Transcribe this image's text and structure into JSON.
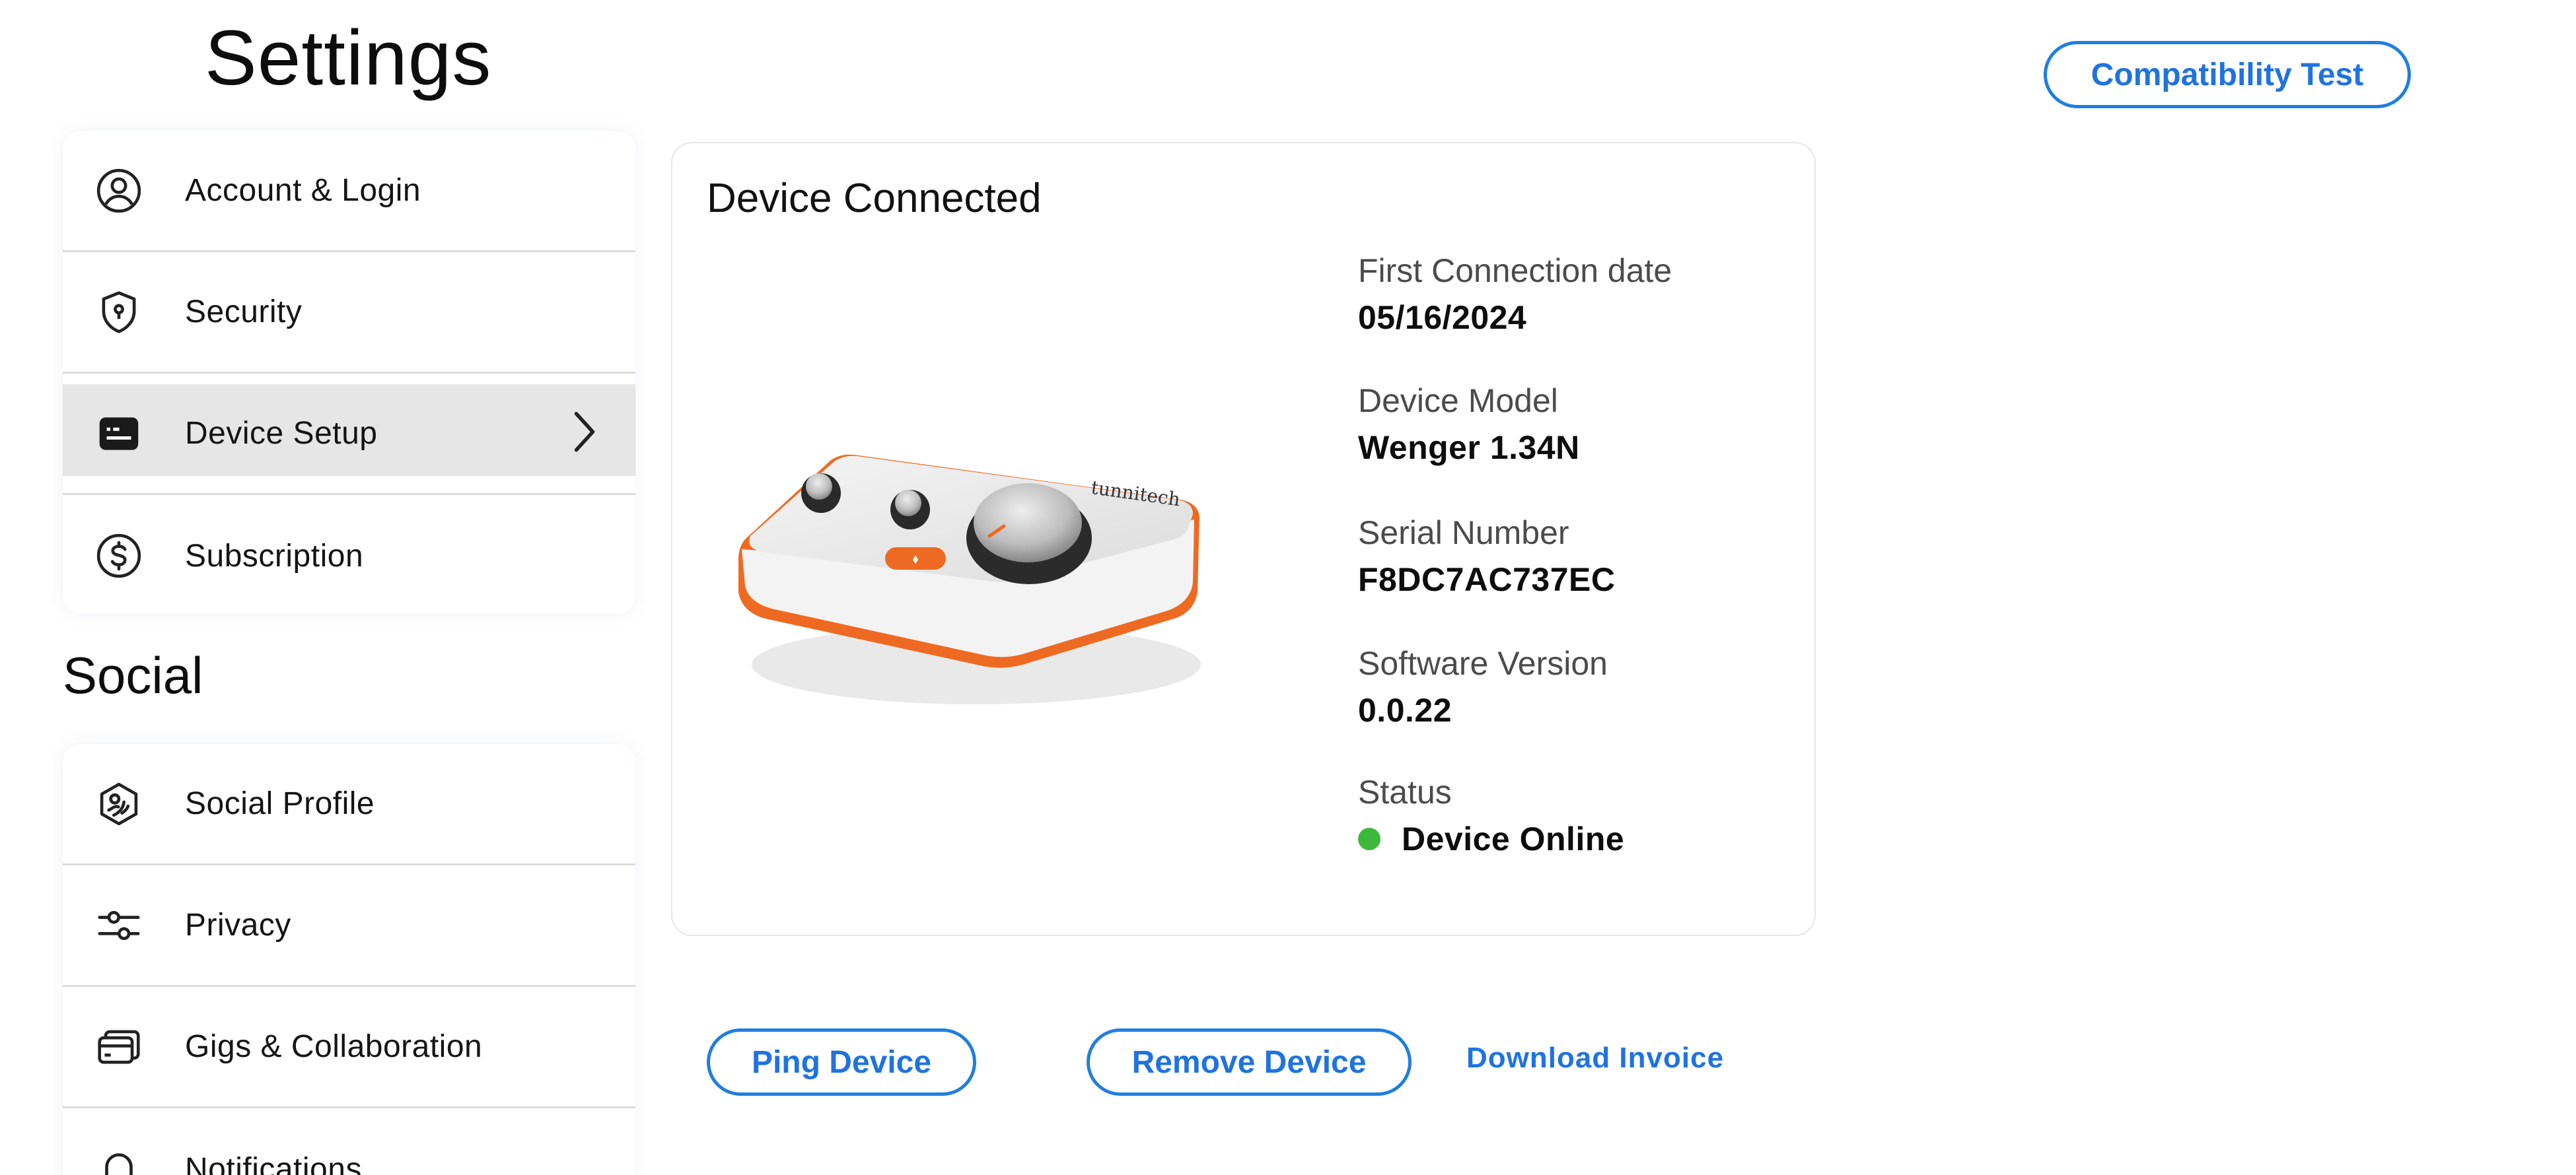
{
  "page": {
    "title": "Settings"
  },
  "header": {
    "compatibility_test_label": "Compatibility Test"
  },
  "account_menu": {
    "items": [
      {
        "label": "Account & Login",
        "icon": "user-circle-icon"
      },
      {
        "label": "Security",
        "icon": "shield-icon"
      },
      {
        "label": "Device Setup",
        "icon": "device-setup-icon",
        "active": true
      },
      {
        "label": "Subscription",
        "icon": "dollar-circle-icon"
      }
    ]
  },
  "social_section": {
    "title": "Social",
    "items": [
      {
        "label": "Social Profile",
        "icon": "social-profile-icon"
      },
      {
        "label": "Privacy",
        "icon": "sliders-icon"
      },
      {
        "label": "Gigs & Collaboration",
        "icon": "cards-icon"
      },
      {
        "label": "Notifications",
        "icon": "bell-icon"
      }
    ]
  },
  "device": {
    "title": "Device Connected",
    "first_connection_label": "First Connection date",
    "first_connection_value": "05/16/2024",
    "model_label": "Device Model",
    "model_value": "Wenger 1.34N",
    "serial_label": "Serial Number",
    "serial_value": "F8DC7AC737EC",
    "software_label": "Software Version",
    "software_value": "0.0.22",
    "status_label": "Status",
    "status_value": "Device Online",
    "status_color": "#3cb83a",
    "device_brand_mark": "tunnitech"
  },
  "actions": {
    "ping_label": "Ping Device",
    "remove_label": "Remove Device",
    "download_label": "Download Invoice"
  },
  "colors": {
    "accent": "#1f73e0",
    "active_item_bg": "#e6e6e6",
    "device_orange": "#ee6a22"
  }
}
